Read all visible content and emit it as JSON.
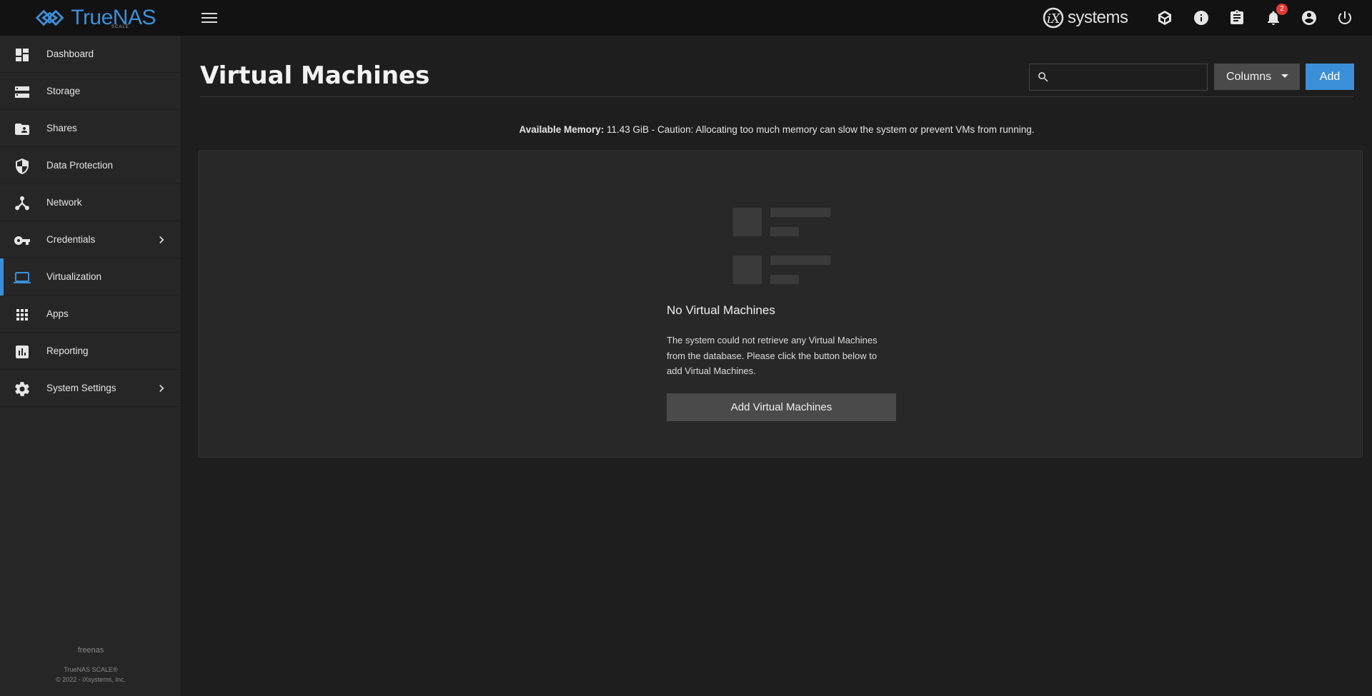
{
  "topbar": {
    "brand": "TrueNAS",
    "brand_sub": "SCALE",
    "vendor": "systems",
    "notification_count": "2"
  },
  "sidebar": {
    "items": [
      {
        "label": "Dashboard",
        "icon": "dashboard-icon"
      },
      {
        "label": "Storage",
        "icon": "storage-icon"
      },
      {
        "label": "Shares",
        "icon": "shares-folder-icon"
      },
      {
        "label": "Data Protection",
        "icon": "shield-icon"
      },
      {
        "label": "Network",
        "icon": "network-icon"
      },
      {
        "label": "Credentials",
        "icon": "key-icon",
        "has_children": true
      },
      {
        "label": "Virtualization",
        "icon": "laptop-icon",
        "active": true
      },
      {
        "label": "Apps",
        "icon": "apps-grid-icon"
      },
      {
        "label": "Reporting",
        "icon": "reporting-chart-icon"
      },
      {
        "label": "System Settings",
        "icon": "gear-icon",
        "has_children": true
      }
    ],
    "hostname": "freenas",
    "product": "TrueNAS SCALE®",
    "copyright": "© 2022 - iXsystems, Inc."
  },
  "main": {
    "title": "Virtual Machines",
    "search_placeholder": "",
    "columns_label": "Columns",
    "add_label": "Add",
    "memory_label": "Available Memory:",
    "memory_text": " 11.43 GiB - Caution: Allocating too much memory can slow the system or prevent VMs from running.",
    "empty_title": "No Virtual Machines",
    "empty_message": "The system could not retrieve any Virtual Machines from the database. Please click the button below to add Virtual Machines.",
    "empty_button": "Add Virtual Machines"
  },
  "colors": {
    "accent": "#3b8fd9",
    "topbar_bg": "#121212",
    "sidebar_bg": "#262626",
    "content_bg": "#1e1e1e",
    "badge": "#e53935"
  }
}
